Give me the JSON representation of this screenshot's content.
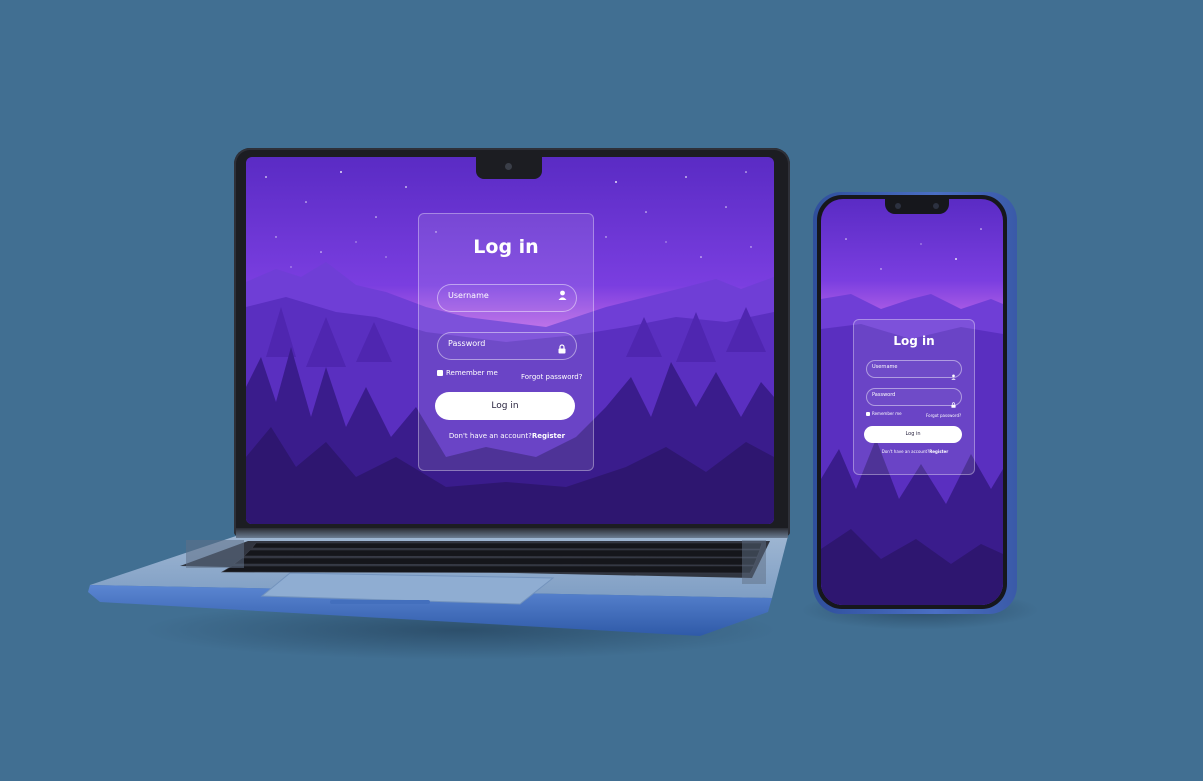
{
  "login": {
    "title": "Log in",
    "username_placeholder": "Username",
    "password_placeholder": "Password",
    "remember_label": "Remember me",
    "forgot_label": "Forgot password?",
    "button_label": "Log in",
    "no_account_text": "Don't have an account?",
    "register_label": "Register"
  },
  "icons": {
    "username": "user-icon",
    "password": "lock-icon"
  },
  "colors": {
    "background": "#416f92",
    "sky_top": "#5a2bc4",
    "horizon_glow": "#c86ee8",
    "forest_dark": "#3a1c8c",
    "button_bg": "#ffffff"
  }
}
